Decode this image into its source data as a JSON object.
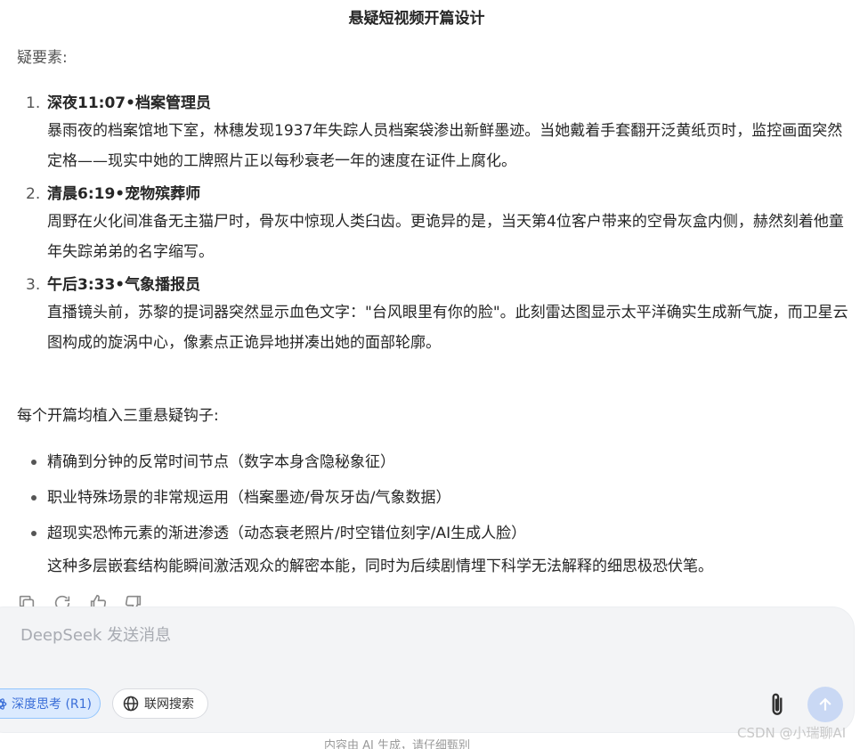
{
  "title": "悬疑短视频开篇设计",
  "intro": "疑要素:",
  "openings": [
    {
      "number": "1.",
      "heading": "深夜11:07•档案管理员",
      "body": "暴雨夜的档案馆地下室，林穗发现1937年失踪人员档案袋渗出新鲜墨迹。当她戴着手套翻开泛黄纸页时，监控画面突然定格——现实中她的工牌照片正以每秒衰老一年的速度在证件上腐化。"
    },
    {
      "number": "2.",
      "heading": "清晨6:19•宠物殡葬师",
      "body": "周野在火化间准备无主猫尸时，骨灰中惊现人类臼齿。更诡异的是，当天第4位客户带来的空骨灰盒内侧，赫然刻着他童年失踪弟弟的名字缩写。"
    },
    {
      "number": "3.",
      "heading": "午后3:33•气象播报员",
      "body": "直播镜头前，苏黎的提词器突然显示血色文字：\"台风眼里有你的脸\"。此刻雷达图显示太平洋确实生成新气旋，而卫星云图构成的旋涡中心，像素点正诡异地拼凑出她的面部轮廓。"
    }
  ],
  "hooks_intro": "每个开篇均植入三重悬疑钩子:",
  "hooks": [
    "精确到分钟的反常时间节点（数字本身含隐秘象征）",
    "职业特殊场景的非常规运用（档案墨迹/骨灰牙齿/气象数据）",
    "超现实恐怖元素的渐进渗透（动态衰老照片/时空错位刻字/AI生成人脸）"
  ],
  "conclusion": "这种多层嵌套结构能瞬间激活观众的解密本能，同时为后续剧情埋下科学无法解释的细思极恐伏笔。",
  "actions": {
    "icons": [
      "copy-icon",
      "regenerate-icon",
      "thumbs-up-icon",
      "thumbs-down-icon"
    ]
  },
  "composer": {
    "placeholder": "DeepSeek 发送消息",
    "deep_think_label": "深度思考 (R1)",
    "web_search_label": "联网搜索"
  },
  "footer_note": "内容由 AI 生成，请仔细甄别",
  "watermark": "CSDN @小瑞聊AI",
  "colors": {
    "accent": "#3b6fd8",
    "deep_think_bg": "#dbeafe",
    "send_button": "#c9d8f4",
    "composer_bg": "#f3f4f6"
  }
}
